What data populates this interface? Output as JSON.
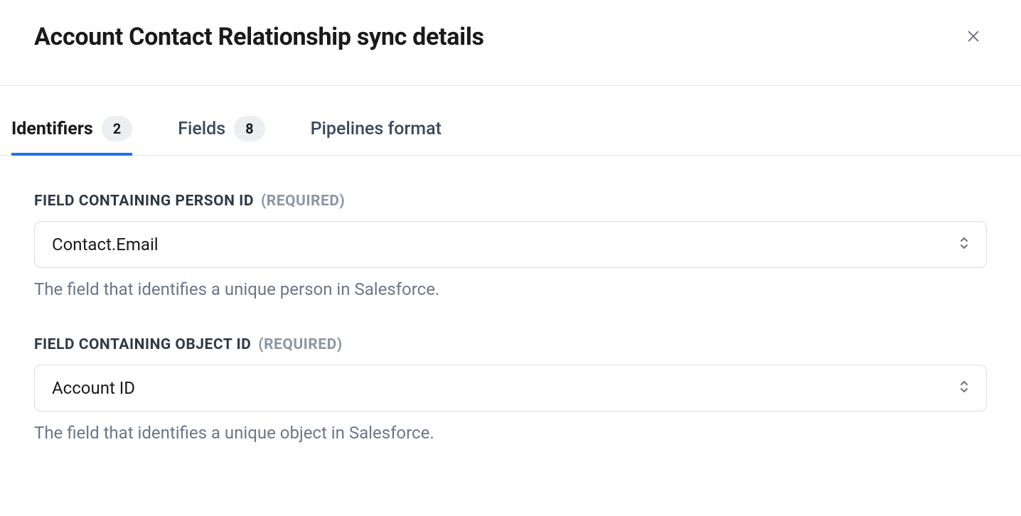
{
  "header": {
    "title": "Account Contact Relationship sync details"
  },
  "tabs": {
    "identifiers": {
      "label": "Identifiers",
      "count": "2"
    },
    "fields": {
      "label": "Fields",
      "count": "8"
    },
    "pipelines": {
      "label": "Pipelines format"
    }
  },
  "form": {
    "personId": {
      "label": "FIELD CONTAINING PERSON ID",
      "required": "(REQUIRED)",
      "value": "Contact.Email",
      "help": "The field that identifies a unique person in Salesforce."
    },
    "objectId": {
      "label": "FIELD CONTAINING OBJECT ID",
      "required": "(REQUIRED)",
      "value": "Account ID",
      "help": "The field that identifies a unique object in Salesforce."
    }
  }
}
